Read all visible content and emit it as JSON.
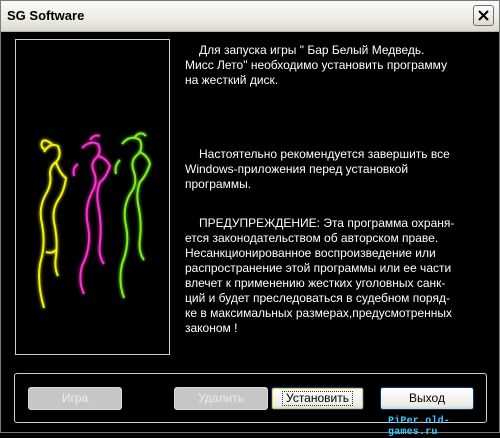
{
  "window": {
    "title": "SG Software"
  },
  "titlebar": {
    "close_icon": "close-icon"
  },
  "message": {
    "paragraph1": "Для запуска игры \" Бар  Белый Медведь.\nМисс Лето\" необходимо установить  программу\nна  жесткий диск.",
    "paragraph2": "Настоятельно рекомендуется завершить все\nWindows-приложения перед установкой\nпрограммы.",
    "paragraph3": "ПРЕДУПРЕЖДЕНИЕ: Эта  программа охраня-\nется законодательством   об авторском праве.\nНесанкционированное  воспроизведение   или\nраспространение этой  программы или ее части\nвлечет к применению жестких уголовных  санк-\nций и будет преследоваться в судебном поряд-\nке в максимальных размерах,предусмотренных\nзаконом !"
  },
  "image": {
    "icon": "neon-dancers-image",
    "colors": [
      "#f2f20c",
      "#ff2fd0",
      "#7cf01c"
    ]
  },
  "buttons": {
    "game": {
      "label": "Игра",
      "enabled": false
    },
    "remove": {
      "label": "Удалить",
      "enabled": false
    },
    "install": {
      "label": "Установить",
      "enabled": true,
      "default": true
    },
    "exit": {
      "label": "Выход",
      "enabled": true
    }
  },
  "watermark": {
    "text": "PiPer.old-games.ru"
  }
}
